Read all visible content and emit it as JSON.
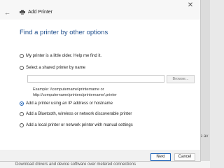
{
  "window": {
    "title": "Add Printer",
    "heading": "Find a printer by other options"
  },
  "options": [
    {
      "label": "My printer is a little older. Help me find it.",
      "checked": false
    },
    {
      "label": "Select a shared printer by name",
      "checked": false
    },
    {
      "label": "Add a printer using an IP address or hostname",
      "checked": true
    },
    {
      "label": "Add a Bluetooth, wireless or network discoverable printer",
      "checked": false
    },
    {
      "label": "Add a local printer or network printer with manual settings",
      "checked": false
    }
  ],
  "shared_printer": {
    "value": "",
    "browse_label": "Browse...",
    "example_line1": "Example: \\\\computername\\printername or",
    "example_line2": "http://computername/printers/printername/.printer"
  },
  "buttons": {
    "next": "Next",
    "cancel": "Cancel"
  },
  "icons": {
    "close": "close-icon",
    "back": "back-arrow-icon",
    "app": "printer-icon"
  },
  "background": {
    "side_text": "e av",
    "bottom_text": "Download drivers and device software over metered connections"
  }
}
